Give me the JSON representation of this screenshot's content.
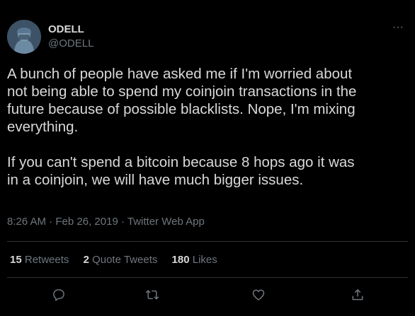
{
  "tweet": {
    "author": {
      "name": "ODELL",
      "handle": "@ODELL"
    },
    "text": "A bunch of people have asked me if I'm worried about\nnot being able to spend my coinjoin transactions in the\nfuture because of possible blacklists. Nope, I'm mixing\neverything.\n\nIf you can't spend a bitcoin because 8 hops ago it was\nin a coinjoin, we will have much bigger issues.",
    "time": "8:26 AM",
    "date": "Feb 26, 2019",
    "source": "Twitter Web App",
    "separator": "·",
    "more_label": "···"
  },
  "stats": {
    "retweets": {
      "count": "15",
      "label": "Retweets"
    },
    "quotes": {
      "count": "2",
      "label": "Quote Tweets"
    },
    "likes": {
      "count": "180",
      "label": "Likes"
    }
  },
  "actions": [
    "reply-icon",
    "retweet-icon",
    "like-icon",
    "share-icon"
  ],
  "colors": {
    "background": "#000000",
    "text": "#d9d9d9",
    "muted": "#6e767d",
    "divider": "#2f3336"
  }
}
